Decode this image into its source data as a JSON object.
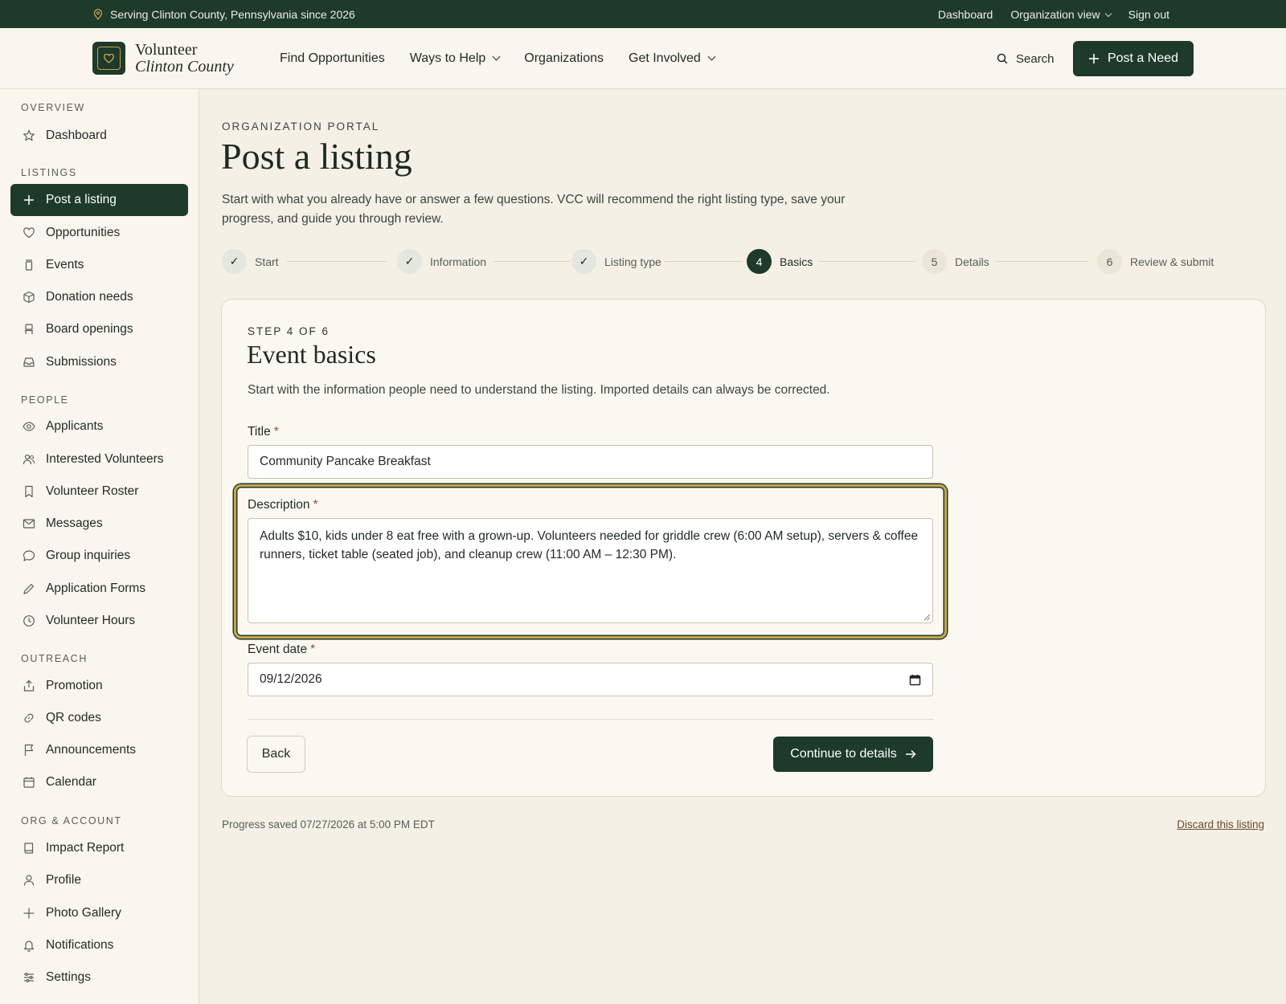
{
  "topbar": {
    "location": "Serving Clinton County, Pennsylvania since 2026",
    "links": [
      "Dashboard",
      "Organization view",
      "Sign out"
    ]
  },
  "header": {
    "logo_line1": "Volunteer",
    "logo_line2": "Clinton County",
    "nav": [
      "Find Opportunities",
      "Ways to Help",
      "Organizations",
      "Get Involved"
    ],
    "search_label": "Search",
    "post_need_label": "Post a Need"
  },
  "sidebar": {
    "sections": [
      {
        "title": "OVERVIEW",
        "items": [
          "Dashboard"
        ]
      },
      {
        "title": "LISTINGS",
        "items": [
          "Post a listing",
          "Opportunities",
          "Events",
          "Donation needs",
          "Board openings",
          "Submissions"
        ]
      },
      {
        "title": "PEOPLE",
        "items": [
          "Applicants",
          "Interested Volunteers",
          "Volunteer Roster",
          "Messages",
          "Group inquiries",
          "Application Forms",
          "Volunteer Hours"
        ]
      },
      {
        "title": "OUTREACH",
        "items": [
          "Promotion",
          "QR codes",
          "Announcements",
          "Calendar"
        ]
      },
      {
        "title": "ORG & ACCOUNT",
        "items": [
          "Impact Report",
          "Profile",
          "Photo Gallery",
          "Notifications",
          "Settings"
        ]
      }
    ],
    "active_item": "Post a listing"
  },
  "page": {
    "eyebrow": "ORGANIZATION PORTAL",
    "title": "Post a listing",
    "description": "Start with what you already have or answer a few questions. VCC will recommend the right listing type, save your progress, and guide you through review."
  },
  "stepper": [
    {
      "marker": "✓",
      "label": "Start",
      "state": "done"
    },
    {
      "marker": "✓",
      "label": "Information",
      "state": "done"
    },
    {
      "marker": "✓",
      "label": "Listing type",
      "state": "done"
    },
    {
      "marker": "4",
      "label": "Basics",
      "state": "current"
    },
    {
      "marker": "5",
      "label": "Details",
      "state": "future"
    },
    {
      "marker": "6",
      "label": "Review & submit",
      "state": "future"
    }
  ],
  "form": {
    "eyebrow": "STEP 4 OF 6",
    "title": "Event basics",
    "description": "Start with the information people need to understand the listing. Imported details can always be corrected.",
    "title_label": "Title",
    "title_value": "Community Pancake Breakfast",
    "description_label": "Description",
    "description_value": "Adults $10, kids under 8 eat free with a grown-up. Volunteers needed for griddle crew (6:00 AM setup), servers & coffee runners, ticket table (seated job), and cleanup crew (11:00 AM – 12:30 PM).",
    "date_label": "Event date",
    "date_value": "09/12/2026",
    "required_mark": "*",
    "back_label": "Back",
    "continue_label": "Continue to details"
  },
  "footer": {
    "saved": "Progress saved 07/27/2026 at 5:00 PM EDT",
    "discard": "Discard this listing"
  },
  "colors": {
    "brand_dark_green": "#1d3a2a",
    "gold_accent": "#c9a34a",
    "background": "#f5f0e6"
  }
}
